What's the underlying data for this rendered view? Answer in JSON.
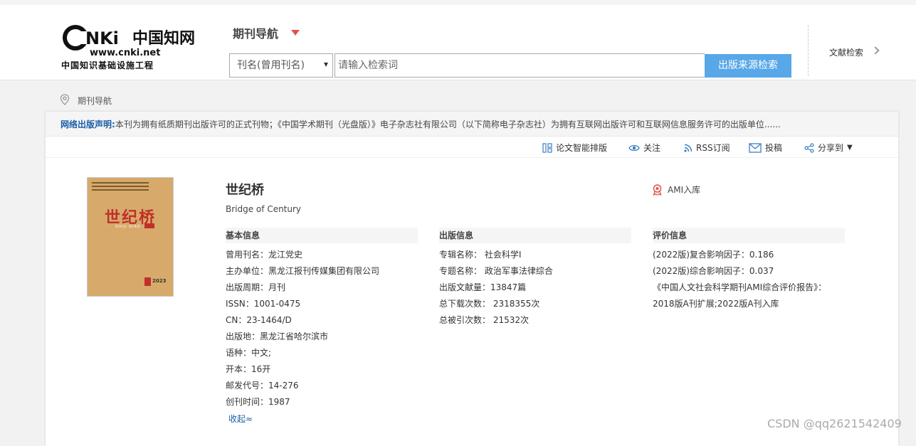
{
  "header": {
    "logo_main": "CNKi中国知网",
    "logo_url": "www.cnki.net",
    "logo_sub": "中国知识基础设施工程",
    "nav_title": "期刊导航",
    "search_select": "刊名(曾用刊名)",
    "search_placeholder": "请输入检索词",
    "search_button": "出版来源检索",
    "lit_search": "文献检索"
  },
  "breadcrumb": "期刊导航",
  "notice": {
    "label": "网络出版声明:",
    "text": "本刊为拥有纸质期刊出版许可的正式刊物；《中国学术期刊（光盘版）》电子杂志社有限公司（以下简称电子杂志社）为拥有互联网出版许可和互联网信息服务许可的出版单位......"
  },
  "toolbar": {
    "smart_layout": "论文智能排版",
    "follow": "关注",
    "rss": "RSS订阅",
    "submit": "投稿",
    "share": "分享到"
  },
  "cover": {
    "title": "世纪桥",
    "pinyin": "SHIJI QIAO",
    "year": "2023"
  },
  "journal": {
    "title": "世纪桥",
    "english_title": "Bridge of Century",
    "ami": "AMI入库"
  },
  "basic": {
    "heading": "基本信息",
    "rows": [
      "曾用刊名：龙江党史",
      "主办单位：黑龙江报刊传媒集团有限公司",
      "出版周期：月刊",
      "ISSN：1001-0475",
      "CN：23-1464/D",
      "出版地：黑龙江省哈尔滨市",
      "语种：中文;",
      "开本：16开",
      "邮发代号：14-276",
      "创刊时间：1987"
    ],
    "collapse": "收起≈"
  },
  "publish": {
    "heading": "出版信息",
    "rows": [
      "专辑名称：  社会科学I",
      "专题名称：  政治军事法律综合",
      "出版文献量：13847篇",
      "总下载次数：  2318355次",
      "总被引次数：  21532次"
    ]
  },
  "evaluation": {
    "heading": "评价信息",
    "rows": [
      "(2022版)复合影响因子：0.186",
      "(2022版)综合影响因子：0.037",
      "《中国人文社会科学期刊AMI综合评价报告》：",
      "2018版A刊扩展;2022版A刊入库"
    ]
  },
  "watermark": "CSDN @qq2621542409",
  "colors": {
    "accent": "#58a7e8",
    "link": "#1a5ea8",
    "caret": "#e0534a",
    "cover_bg": "#d7aa6b"
  }
}
